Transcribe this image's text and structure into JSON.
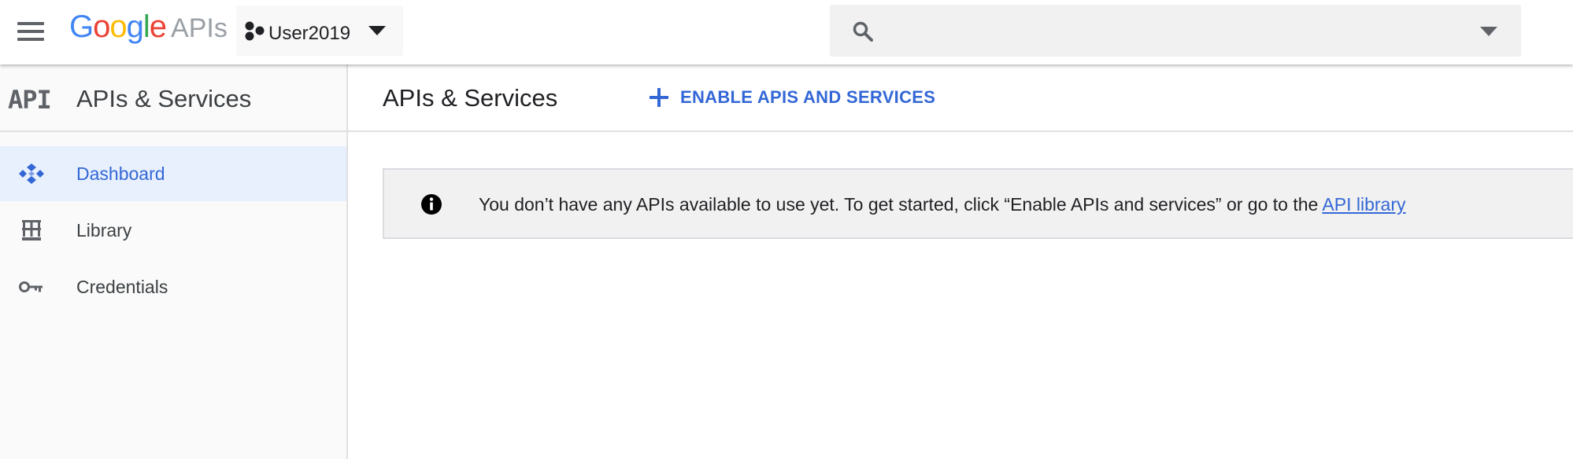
{
  "topbar": {
    "menu_icon": "hamburger-menu-icon",
    "logo": {
      "letters": [
        {
          "char": "G",
          "color": "#4285F4"
        },
        {
          "char": "o",
          "color": "#EA4335"
        },
        {
          "char": "o",
          "color": "#FBBC05"
        },
        {
          "char": "g",
          "color": "#4285F4"
        },
        {
          "char": "l",
          "color": "#34A853"
        },
        {
          "char": "e",
          "color": "#EA4335"
        }
      ],
      "suffix": "APIs"
    },
    "project": {
      "name": "User2019",
      "icon": "project-dots-icon",
      "caret_icon": "caret-down-icon"
    },
    "search": {
      "value": "",
      "placeholder": "",
      "icon": "search-icon",
      "dropdown_icon": "caret-down-icon"
    }
  },
  "sidebar": {
    "logo_text": "API",
    "title": "APIs & Services",
    "items": [
      {
        "label": "Dashboard",
        "icon": "dashboard-icon",
        "active": true
      },
      {
        "label": "Library",
        "icon": "library-icon",
        "active": false
      },
      {
        "label": "Credentials",
        "icon": "key-icon",
        "active": false
      }
    ]
  },
  "main": {
    "title": "APIs & Services",
    "enable_button": "ENABLE APIS AND SERVICES",
    "notice": {
      "icon": "info-icon",
      "text": "You don’t have any APIs available to use yet. To get started, click “Enable APIs and services” or go to the ",
      "link": "API library"
    }
  },
  "colors": {
    "accent": "#3367d6",
    "active_bg": "#e8f0fe",
    "icon_gray": "#5f6368"
  }
}
